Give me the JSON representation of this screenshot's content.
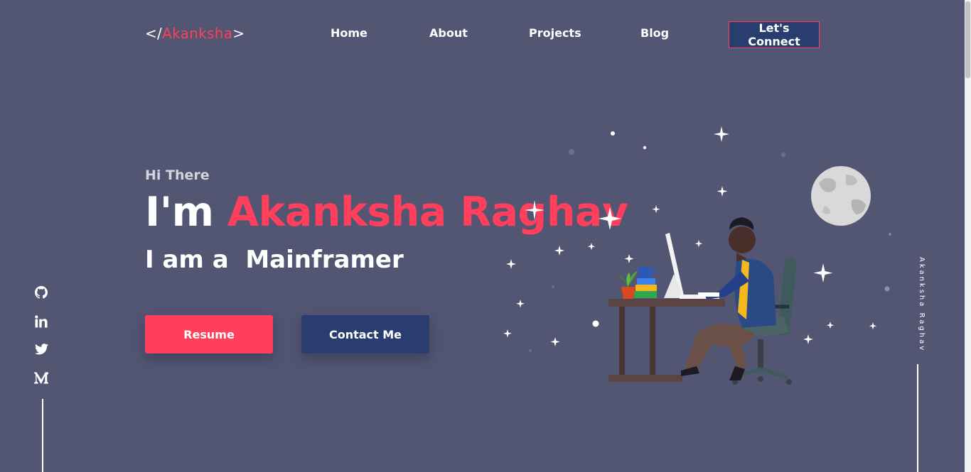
{
  "logo": {
    "prefix": "</",
    "name": "Akanksha",
    "suffix": ">"
  },
  "nav": {
    "items": [
      "Home",
      "About",
      "Projects",
      "Blog"
    ],
    "cta": "Let's Connect"
  },
  "hero": {
    "greeting": "Hi There",
    "intro": "I'm ",
    "name": "Akanksha Raghav",
    "role_prefix": "I am a  ",
    "role": "Mainframer",
    "resume_label": "Resume",
    "contact_label": "Contact Me"
  },
  "social": {
    "icons": [
      "github-icon",
      "linkedin-icon",
      "twitter-icon",
      "medium-icon"
    ]
  },
  "side_name": "Akanksha Raghav",
  "colors": {
    "background": "#525673",
    "accent": "#ff3f5b",
    "navy": "#293d6e",
    "text": "#ffffff"
  }
}
